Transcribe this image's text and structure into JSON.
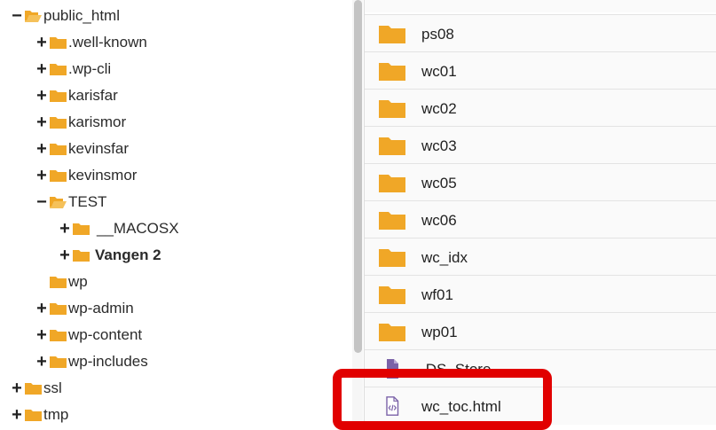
{
  "tree": {
    "items": [
      {
        "label": "public_html",
        "toggle": "−",
        "icon": "folder-open-icon",
        "bold": false
      },
      {
        "label": ".well-known",
        "toggle": "+",
        "icon": "folder-icon",
        "bold": false
      },
      {
        "label": ".wp-cli",
        "toggle": "+",
        "icon": "folder-icon",
        "bold": false
      },
      {
        "label": "karisfar",
        "toggle": "+",
        "icon": "folder-icon",
        "bold": false
      },
      {
        "label": "karismor",
        "toggle": "+",
        "icon": "folder-icon",
        "bold": false
      },
      {
        "label": "kevinsfar",
        "toggle": "+",
        "icon": "folder-icon",
        "bold": false
      },
      {
        "label": "kevinsmor",
        "toggle": "+",
        "icon": "folder-icon",
        "bold": false
      },
      {
        "label": "TEST",
        "toggle": "−",
        "icon": "folder-open-icon",
        "bold": false
      },
      {
        "label": "__MACOSX",
        "toggle": "+",
        "icon": "folder-icon",
        "bold": false
      },
      {
        "label": "Vangen 2",
        "toggle": "+",
        "icon": "folder-icon",
        "bold": true
      },
      {
        "label": "wp",
        "toggle": "",
        "icon": "folder-icon",
        "bold": false
      },
      {
        "label": "wp-admin",
        "toggle": "+",
        "icon": "folder-icon",
        "bold": false
      },
      {
        "label": "wp-content",
        "toggle": "+",
        "icon": "folder-icon",
        "bold": false
      },
      {
        "label": "wp-includes",
        "toggle": "+",
        "icon": "folder-icon",
        "bold": false
      },
      {
        "label": "ssl",
        "toggle": "+",
        "icon": "folder-icon",
        "bold": false
      },
      {
        "label": "tmp",
        "toggle": "+",
        "icon": "folder-icon",
        "bold": false
      }
    ]
  },
  "files": {
    "rows": [
      {
        "name": "ps08",
        "icon": "folder-icon"
      },
      {
        "name": "wc01",
        "icon": "folder-icon"
      },
      {
        "name": "wc02",
        "icon": "folder-icon"
      },
      {
        "name": "wc03",
        "icon": "folder-icon"
      },
      {
        "name": "wc05",
        "icon": "folder-icon"
      },
      {
        "name": "wc06",
        "icon": "folder-icon"
      },
      {
        "name": "wc_idx",
        "icon": "folder-icon"
      },
      {
        "name": "wf01",
        "icon": "folder-icon"
      },
      {
        "name": "wp01",
        "icon": "folder-icon"
      },
      {
        "name": ".DS_Store",
        "icon": "file-icon"
      },
      {
        "name": "wc_toc.html",
        "icon": "html-file-icon"
      }
    ]
  },
  "colors": {
    "folder": "#f0a727",
    "folder_tab": "#f5c15a",
    "file_icon": "#7b62a8",
    "highlight": "#e10000"
  }
}
